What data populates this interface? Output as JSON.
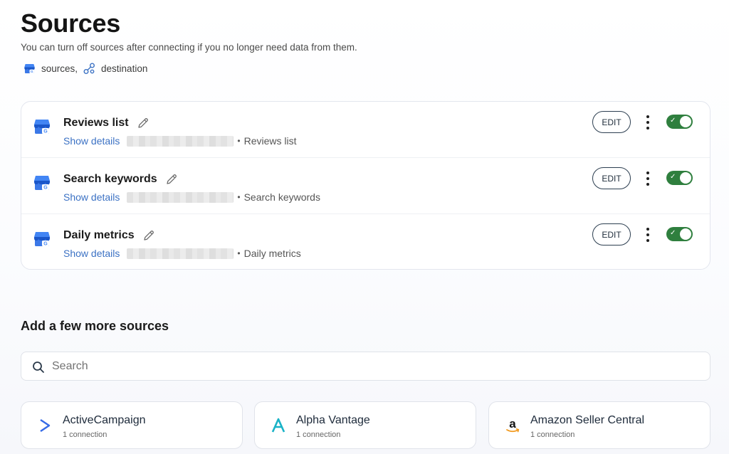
{
  "header": {
    "title": "Sources",
    "subtitle": "You can turn off sources after connecting if you no longer need data from them.",
    "legend_sources": "sources,",
    "legend_destination": "destination"
  },
  "sources": [
    {
      "name": "Reviews list",
      "details_link": "Show details",
      "sep": "•",
      "description": "Reviews list",
      "edit_label": "EDIT",
      "enabled": true,
      "icon": "google-business-profile-icon"
    },
    {
      "name": "Search keywords",
      "details_link": "Show details",
      "sep": "•",
      "description": "Search keywords",
      "edit_label": "EDIT",
      "enabled": true,
      "icon": "google-business-profile-icon"
    },
    {
      "name": "Daily metrics",
      "details_link": "Show details",
      "sep": "•",
      "description": "Daily metrics",
      "edit_label": "EDIT",
      "enabled": true,
      "icon": "google-business-profile-icon"
    }
  ],
  "toggle_check": "✓",
  "more": {
    "title": "Add a few more sources",
    "search_placeholder": "Search",
    "catalog": [
      {
        "name": "ActiveCampaign",
        "count": "1 connection",
        "icon": "activecampaign-logo-icon"
      },
      {
        "name": "Alpha Vantage",
        "count": "1 connection",
        "icon": "alpha-vantage-logo-icon"
      },
      {
        "name": "Amazon Seller Central",
        "count": "1 connection",
        "icon": "amazon-logo-icon"
      }
    ]
  },
  "colors": {
    "accent_link": "#3c72c4",
    "toggle_on": "#2f7f3e",
    "gbp_blue": "#4285f4"
  }
}
